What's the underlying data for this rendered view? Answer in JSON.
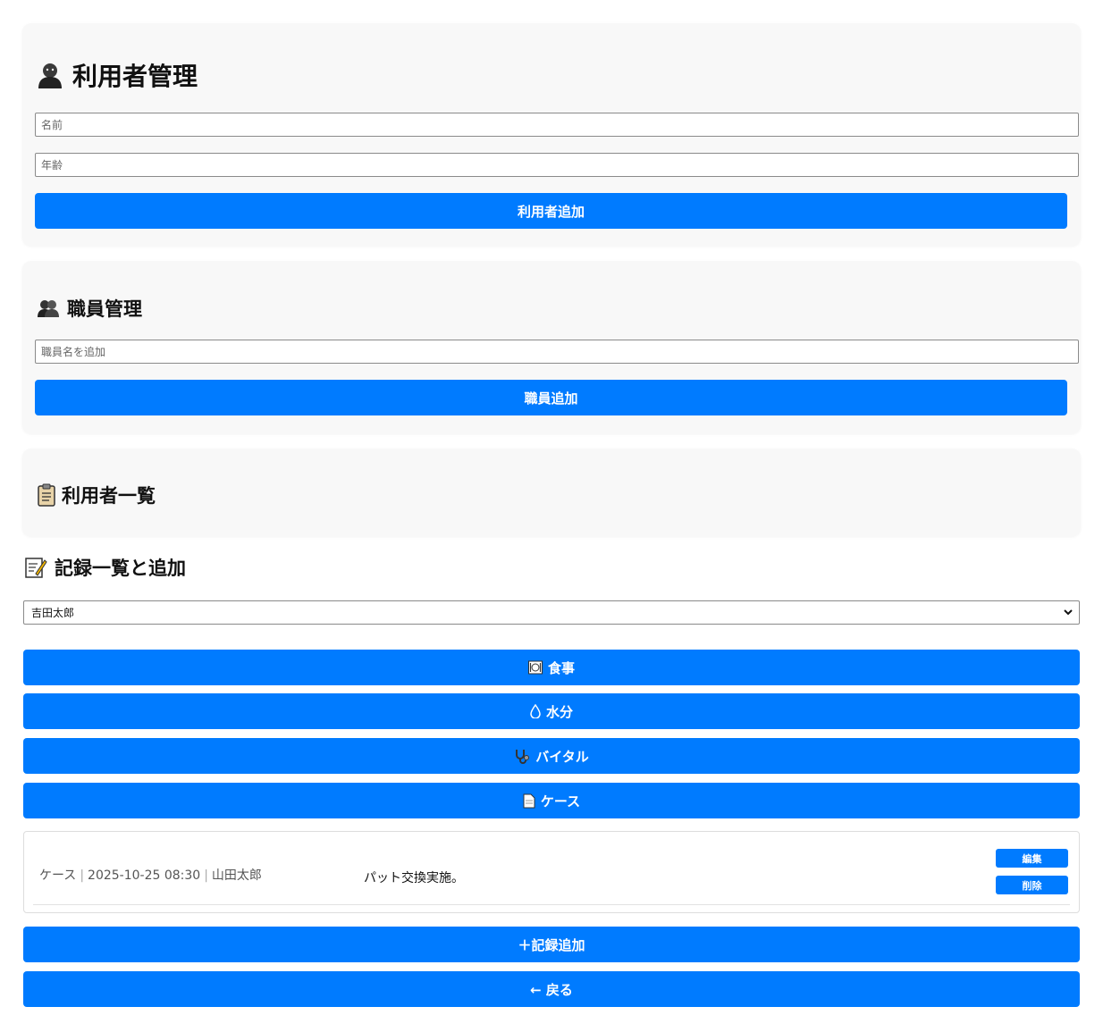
{
  "user_mgmt": {
    "title": "利用者管理",
    "name_placeholder": "名前",
    "age_placeholder": "年齢",
    "add_label": "利用者追加"
  },
  "staff_mgmt": {
    "title": "職員管理",
    "name_placeholder": "職員名を追加",
    "add_label": "職員追加"
  },
  "user_list": {
    "title": "利用者一覧"
  },
  "records": {
    "title": "記録一覧と追加",
    "selected_user": "吉田太郎",
    "category_buttons": [
      {
        "icon": "meal-icon",
        "label": "食事"
      },
      {
        "icon": "water-drop-icon",
        "label": "水分"
      },
      {
        "icon": "stethoscope-icon",
        "label": "バイタル"
      },
      {
        "icon": "document-icon",
        "label": "ケース"
      }
    ],
    "entries": [
      {
        "category": "ケース",
        "datetime": "2025-10-25 08:30",
        "staff": "山田太郎",
        "text": "パット交換実施。",
        "edit_label": "編集",
        "delete_label": "削除"
      }
    ],
    "add_record_label": "＋記録追加",
    "back_label": "← 戻る"
  },
  "colors": {
    "primary": "#007bff",
    "card_bg": "#f8f8f8"
  }
}
